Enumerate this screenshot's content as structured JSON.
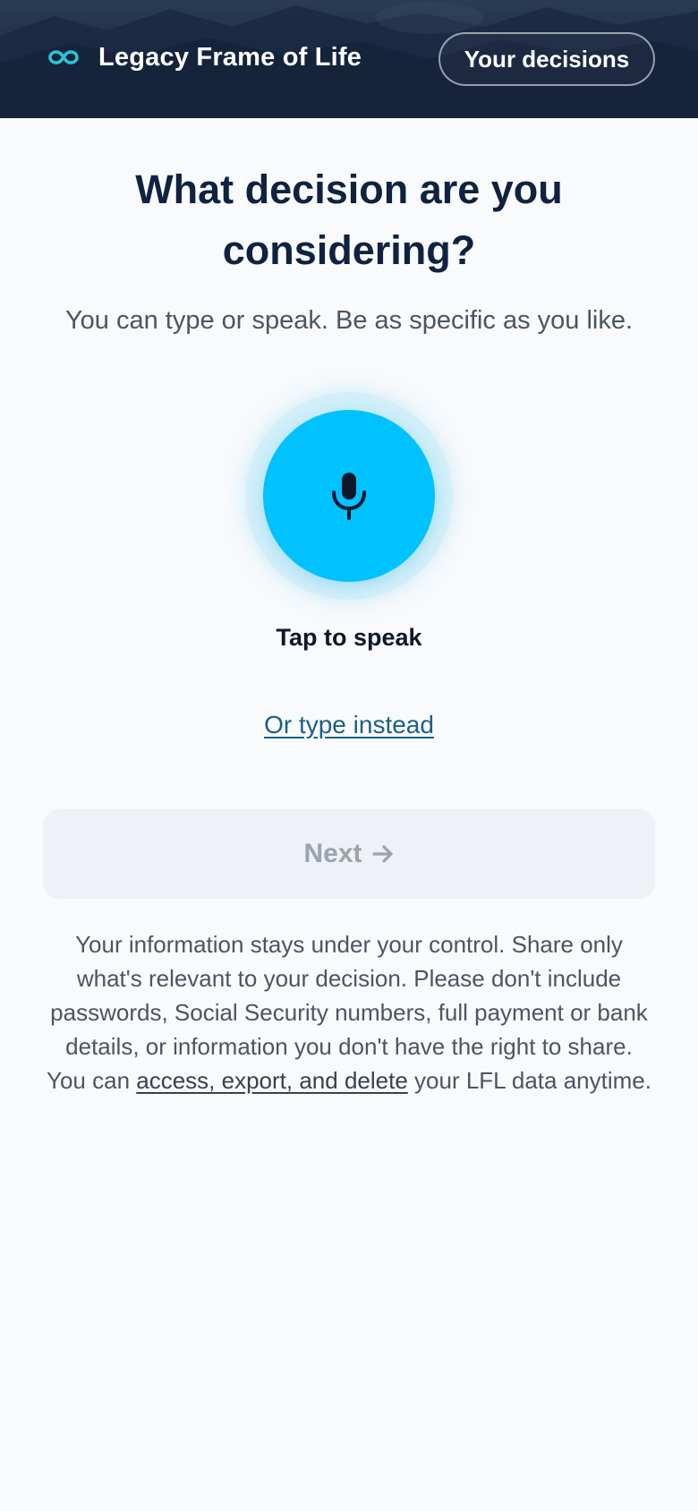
{
  "header": {
    "app_name": "Legacy Frame of Life",
    "logo_icon": "infinity-loop-icon",
    "decisions_button": "Your decisions"
  },
  "main": {
    "title_line1": "What decision are you",
    "title_line2": "considering?",
    "subtitle": "You can type or speak. Be as specific as you like.",
    "mic_icon": "microphone-icon",
    "tap_label": "Tap to speak",
    "type_link": "Or type instead",
    "next_button": "Next",
    "next_icon": "arrow-right-icon"
  },
  "privacy": {
    "text_before": "Your information stays under your control. Share only what's relevant to your decision. Please don't include passwords, Social Security numbers, full payment or bank details, or information you don't have the right to share. You can ",
    "link": "access, export, and delete",
    "text_after": " your LFL data anytime."
  },
  "colors": {
    "accent": "#00c2ff",
    "logo": "#2ec4d6",
    "title": "#0f2340",
    "link": "#1d5f86",
    "disabled_button_bg": "#eef1f5",
    "disabled_button_text": "#9aa3ae"
  }
}
